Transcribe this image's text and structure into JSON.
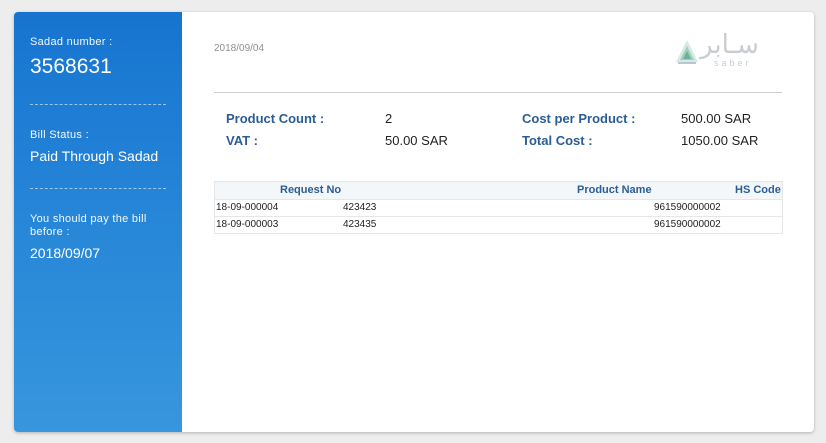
{
  "sidebar": {
    "sadad_label": "Sadad number :",
    "sadad_number": "3568631",
    "status_label": "Bill Status :",
    "status_value": "Paid Through Sadad",
    "due_label": "You should pay the bill before :",
    "due_date": "2018/09/07"
  },
  "bill": {
    "date": "2018/09/04",
    "logo_arabic": "سـابر",
    "logo_latin": "saber"
  },
  "summary": {
    "product_count_label": "Product Count :",
    "product_count": "2",
    "vat_label": "VAT :",
    "vat": "50.00 SAR",
    "cost_per_product_label": "Cost per Product :",
    "cost_per_product": "500.00 SAR",
    "total_cost_label": "Total Cost :",
    "total_cost": "1050.00 SAR"
  },
  "table": {
    "headers": [
      "Request No",
      "Product Name",
      "HS Code"
    ],
    "rows": [
      [
        "18-09-000004",
        "423423",
        "961590000002"
      ],
      [
        "18-09-000003",
        "423435",
        "961590000002"
      ]
    ]
  },
  "colors": {
    "accent": "#1674d0",
    "label": "#2a5d95"
  }
}
